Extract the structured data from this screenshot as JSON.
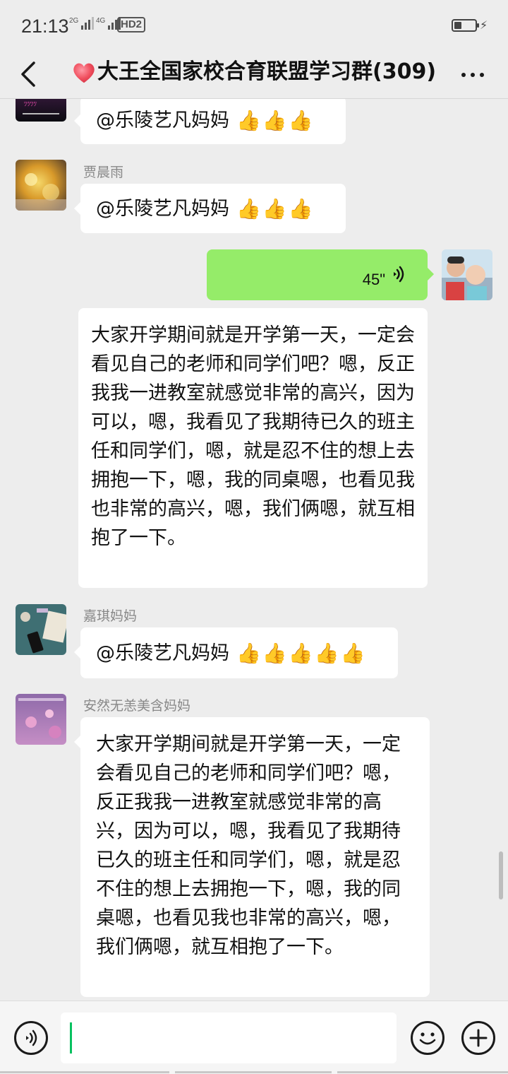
{
  "status_bar": {
    "time": "21:13",
    "network1": "2G",
    "network2": "4G",
    "hd_badge": "HD2",
    "battery_icon": "battery-low-icon",
    "charging_icon": "bolt-icon"
  },
  "header": {
    "back_icon": "chevron-left-icon",
    "heart_icon": "red-heart-emoji",
    "title": "大王全国家校合育联盟学习群(309)",
    "more_icon": "more-dots-icon"
  },
  "messages": [
    {
      "type": "mention",
      "sender": "",
      "text": "@乐陵艺凡妈妈",
      "thumbs": 3
    },
    {
      "type": "mention",
      "sender": "贾晨雨",
      "text": "@乐陵艺凡妈妈",
      "thumbs": 3
    },
    {
      "type": "voice",
      "duration": "45\"",
      "self": true
    },
    {
      "type": "text",
      "text": "大家开学期间就是开学第一天，一定会看见自己的老师和同学们吧？嗯，反正我我一进教室就感觉非常的高兴，因为可以，嗯，我看见了我期待已久的班主任和同学们，嗯，就是忍不住的想上去拥抱一下，嗯，我的同桌嗯，也看见我也非常的高兴，嗯，我们俩嗯，就互相抱了一下。"
    },
    {
      "type": "mention",
      "sender": "嘉琪妈妈",
      "text": "@乐陵艺凡妈妈",
      "thumbs": 5
    },
    {
      "type": "text",
      "sender": "安然无恙美含妈妈",
      "text": "大家开学期间就是开学第一天，一定会看见自己的老师和同学们吧？嗯，反正我我一进教室就感觉非常的高兴，因为可以，嗯，我看见了我期待已久的班主任和同学们，嗯，就是忍不住的想上去拥抱一下，嗯，我的同桌嗯，也看见我也非常的高兴，嗯，我们俩嗯，就互相抱了一下。"
    }
  ],
  "input_bar": {
    "voice_icon": "voice-input-icon",
    "emoji_icon": "emoji-face-icon",
    "add_icon": "plus-circle-icon",
    "input_value": ""
  },
  "colors": {
    "background": "#ededed",
    "self_bubble": "#95ec69",
    "other_bubble": "#ffffff",
    "caret": "#07c160"
  }
}
